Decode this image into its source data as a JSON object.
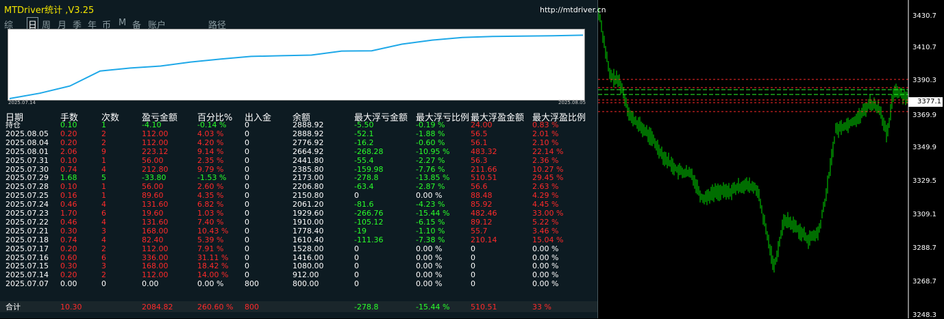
{
  "window": {
    "title": "MTDriver统计  ,V3.25",
    "url": "http://mtdriver.cn"
  },
  "tabs": [
    {
      "label": "综",
      "active": false
    },
    {
      "label": "日",
      "active": true
    },
    {
      "label": "周",
      "active": false
    },
    {
      "label": "月",
      "active": false
    },
    {
      "label": "季",
      "active": false
    },
    {
      "label": "年",
      "active": false
    },
    {
      "label": "币",
      "active": false
    },
    {
      "label": "M",
      "active": false
    },
    {
      "label": "备",
      "active": false
    },
    {
      "label": "账户",
      "active": false
    },
    {
      "label": "路径",
      "active": false
    }
  ],
  "mini_chart": {
    "start_date": "2025.07.14",
    "end_date": "2025.08.05",
    "line_color": "#1ea8e8",
    "values": [
      0,
      16,
      38,
      83,
      92,
      98,
      110,
      119,
      127,
      129,
      131,
      143,
      144,
      164,
      176,
      184,
      187,
      188,
      189,
      191
    ]
  },
  "table": {
    "headers": [
      "日期",
      "手数",
      "次数",
      "盈亏金额",
      "百分比%",
      "出入金",
      "余额",
      "最大浮亏金额",
      "最大浮亏比例",
      "最大浮盈金额",
      "最大浮盈比例"
    ],
    "rows": [
      [
        "持仓",
        "0.10",
        "1",
        "-4.10",
        "-0.14 %",
        "0",
        "2888.92",
        "-5.50",
        "-0.19 %",
        "24.00",
        "0.83 %"
      ],
      [
        "2025.08.05",
        "0.20",
        "2",
        "112.00",
        "4.03 %",
        "0",
        "2888.92",
        "-52.1",
        "-1.88 %",
        "56.5",
        "2.01 %"
      ],
      [
        "2025.08.04",
        "0.20",
        "2",
        "112.00",
        "4.20 %",
        "0",
        "2776.92",
        "-16.2",
        "-0.60 %",
        "56.1",
        "2.10 %"
      ],
      [
        "2025.08.01",
        "2.06",
        "9",
        "223.12",
        "9.14 %",
        "0",
        "2664.92",
        "-268.28",
        "-10.95 %",
        "483.32",
        "22.14 %"
      ],
      [
        "2025.07.31",
        "0.10",
        "1",
        "56.00",
        "2.35 %",
        "0",
        "2441.80",
        "-55.4",
        "-2.27 %",
        "56.3",
        "2.36 %"
      ],
      [
        "2025.07.30",
        "0.74",
        "4",
        "212.80",
        "9.79 %",
        "0",
        "2385.80",
        "-159.98",
        "-7.76 %",
        "211.66",
        "10.27 %"
      ],
      [
        "2025.07.29",
        "1.68",
        "5",
        "-33.80",
        "-1.53 %",
        "0",
        "2173.00",
        "-278.8",
        "-13.85 %",
        "510.51",
        "29.45 %"
      ],
      [
        "2025.07.28",
        "0.10",
        "1",
        "56.00",
        "2.60 %",
        "0",
        "2206.80",
        "-63.4",
        "-2.87 %",
        "56.6",
        "2.63 %"
      ],
      [
        "2025.07.25",
        "0.16",
        "1",
        "89.60",
        "4.35 %",
        "0",
        "2150.80",
        "0",
        "0.00 %",
        "88.48",
        "4.29 %"
      ],
      [
        "2025.07.24",
        "0.46",
        "4",
        "131.60",
        "6.82 %",
        "0",
        "2061.20",
        "-81.6",
        "-4.23 %",
        "85.92",
        "4.45 %"
      ],
      [
        "2025.07.23",
        "1.70",
        "6",
        "19.60",
        "1.03 %",
        "0",
        "1929.60",
        "-266.76",
        "-15.44 %",
        "482.46",
        "33.00 %"
      ],
      [
        "2025.07.22",
        "0.46",
        "4",
        "131.60",
        "7.40 %",
        "0",
        "1910.00",
        "-105.12",
        "-6.15 %",
        "89.12",
        "5.22 %"
      ],
      [
        "2025.07.21",
        "0.30",
        "3",
        "168.00",
        "10.43 %",
        "0",
        "1778.40",
        "-19",
        "-1.10 %",
        "55.7",
        "3.46 %"
      ],
      [
        "2025.07.18",
        "0.74",
        "4",
        "82.40",
        "5.39 %",
        "0",
        "1610.40",
        "-111.36",
        "-7.38 %",
        "210.14",
        "15.04 %"
      ],
      [
        "2025.07.17",
        "0.20",
        "2",
        "112.00",
        "7.91 %",
        "0",
        "1528.00",
        "0",
        "0.00 %",
        "0",
        "0.00 %"
      ],
      [
        "2025.07.16",
        "0.60",
        "6",
        "336.00",
        "31.11 %",
        "0",
        "1416.00",
        "0",
        "0.00 %",
        "0",
        "0.00 %"
      ],
      [
        "2025.07.15",
        "0.30",
        "3",
        "168.00",
        "18.42 %",
        "0",
        "1080.00",
        "0",
        "0.00 %",
        "0",
        "0.00 %"
      ],
      [
        "2025.07.14",
        "0.20",
        "2",
        "112.00",
        "14.00 %",
        "0",
        "912.00",
        "0",
        "0.00 %",
        "0",
        "0.00 %"
      ],
      [
        "2025.07.07",
        "0.00",
        "0",
        "0.00",
        "0.00 %",
        "800",
        "800.00",
        "0",
        "0.00 %",
        "0",
        "0.00 %"
      ]
    ],
    "total": [
      "合计",
      "10.30",
      "",
      "2084.82",
      "260.60 %",
      "800",
      "",
      "-278.8",
      "-15.44 %",
      "510.51",
      "33 %"
    ]
  },
  "price_axis": {
    "labels": [
      "3430.7",
      "3410.7",
      "3390.3",
      "3369.9",
      "3349.9",
      "3329.5",
      "3309.1",
      "3288.7",
      "3268.7",
      "3248.3"
    ],
    "current": "3377.1"
  },
  "colors": {
    "positive": "#ff2a2a",
    "negative": "#2aff2a",
    "neutral": "#ffffff",
    "candle": "#00dd00"
  }
}
